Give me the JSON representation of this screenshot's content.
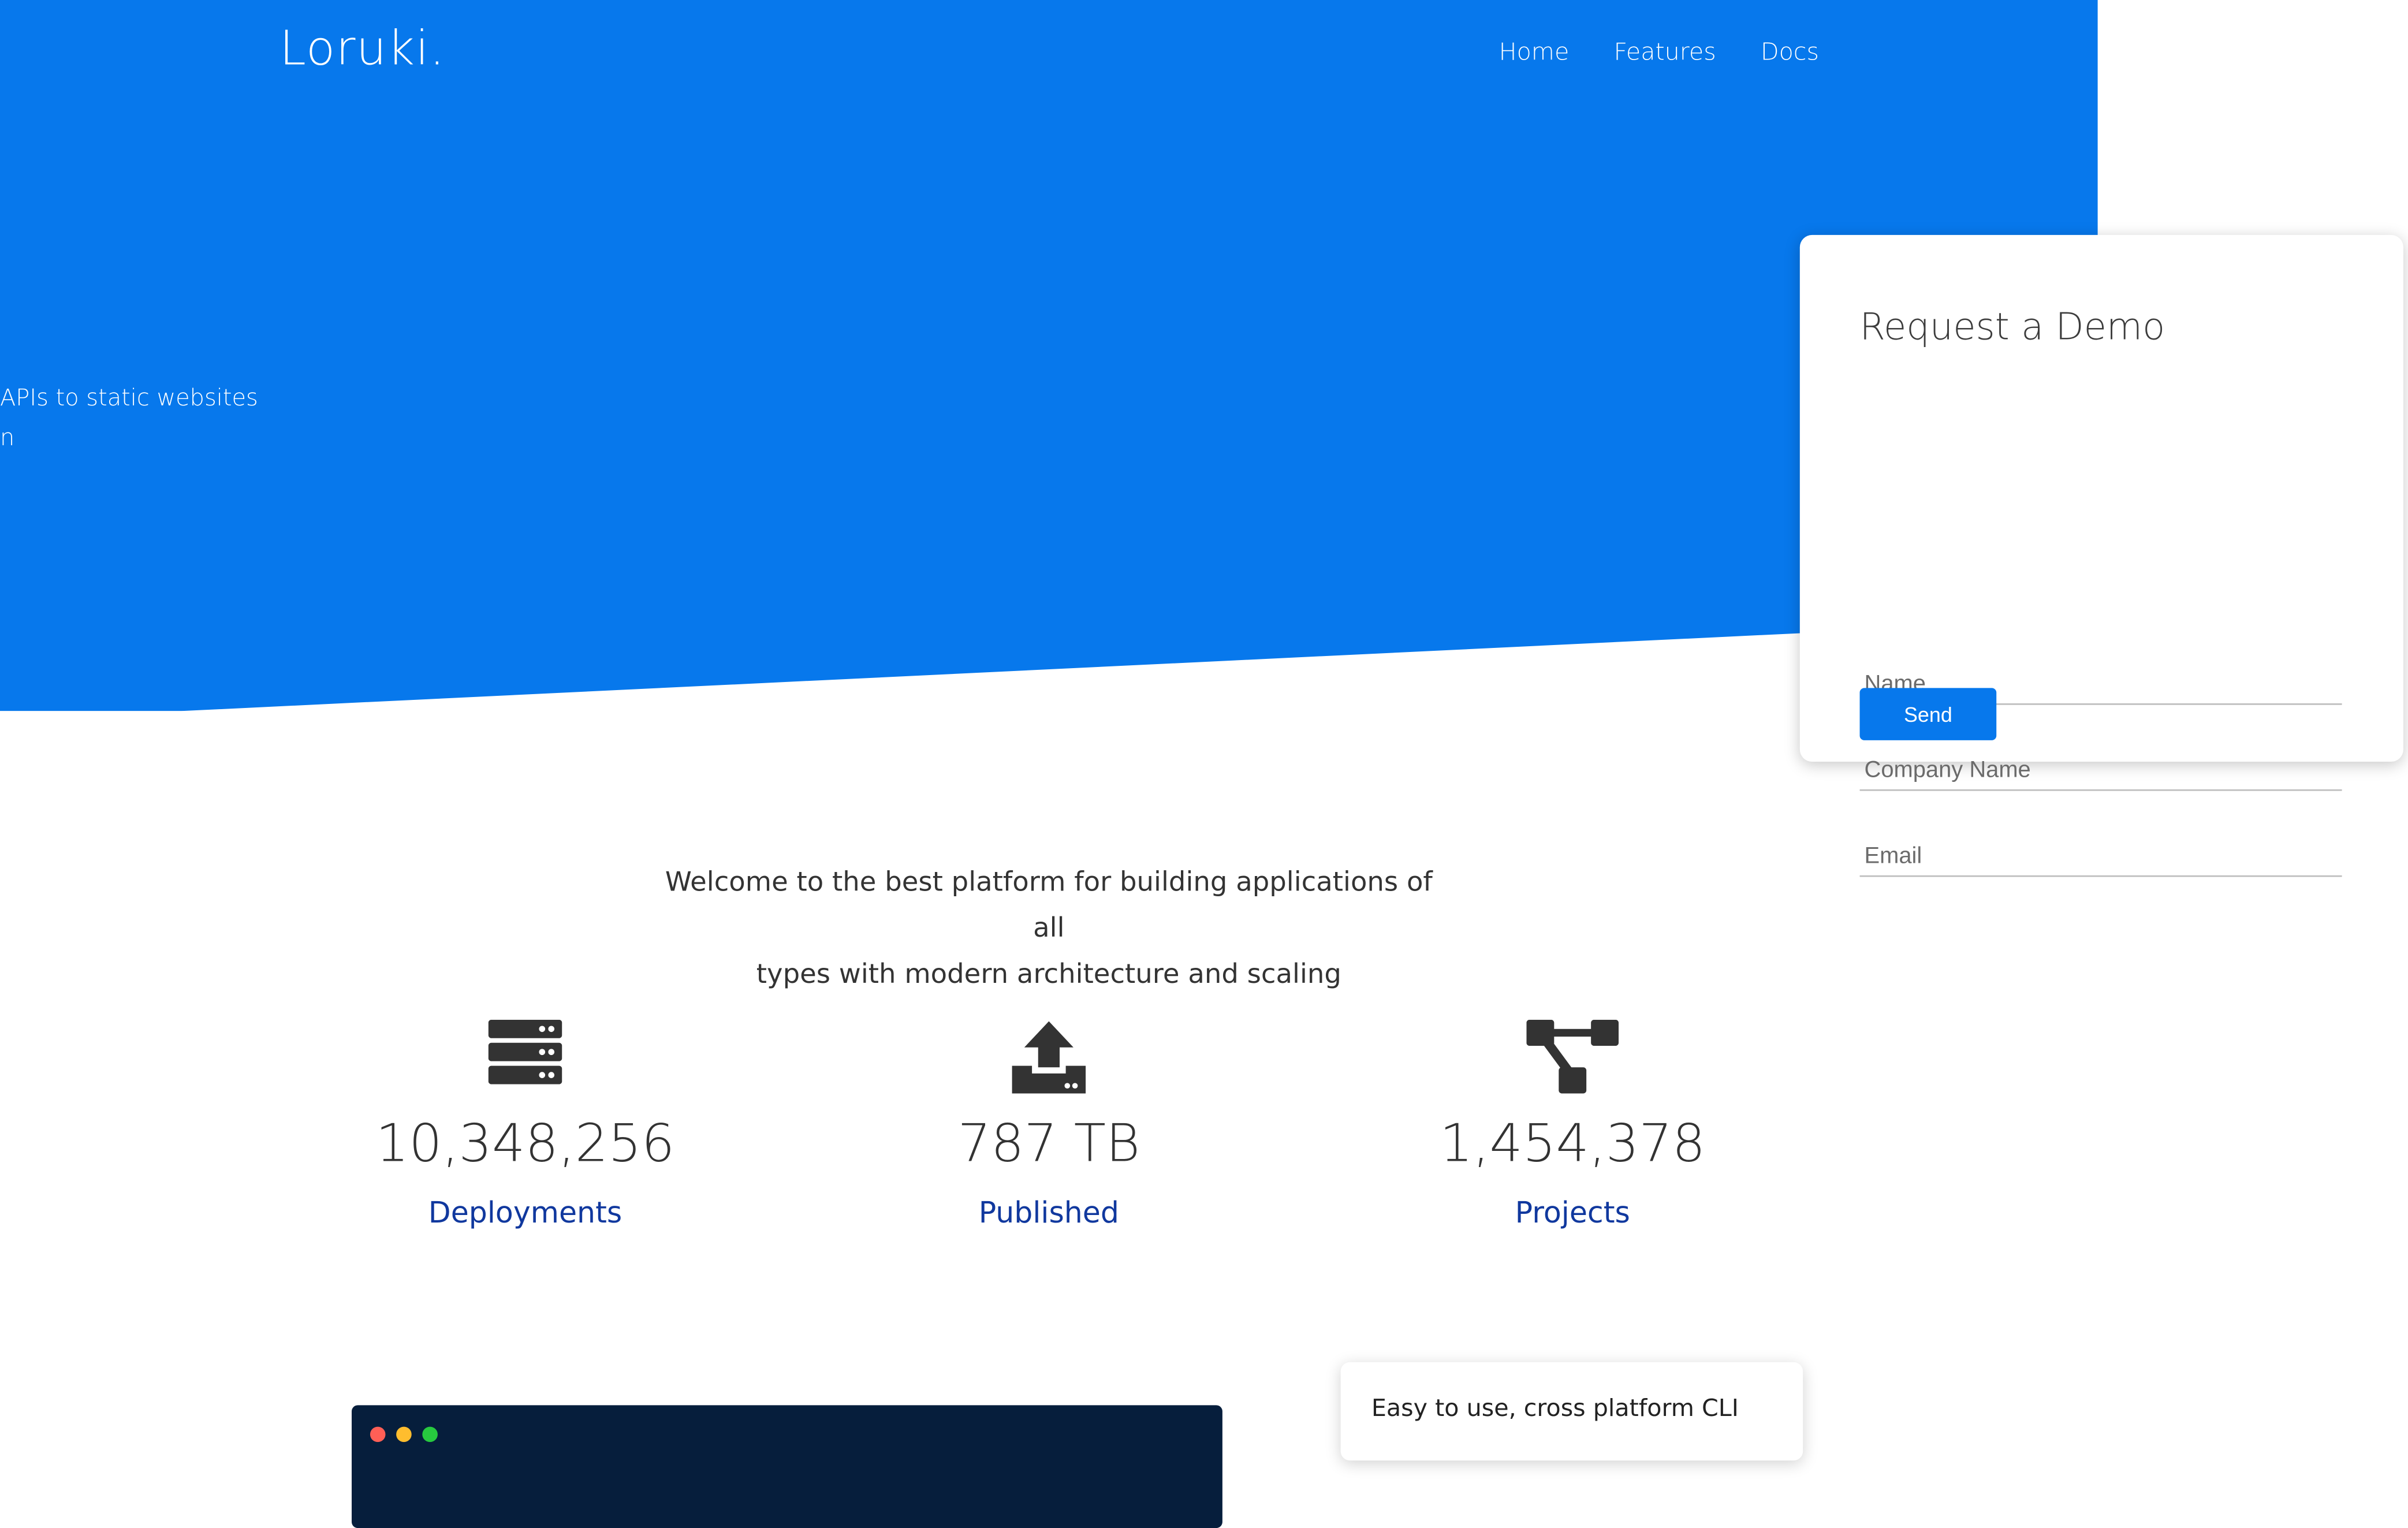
{
  "brand": {
    "logo": "Loruki."
  },
  "nav": {
    "items": [
      "Home",
      "Features",
      "Docs"
    ]
  },
  "hero": {
    "tagline_line1": "APIs to static websites for",
    "tagline_line2": "n"
  },
  "demo_form": {
    "title": "Request a Demo",
    "name_placeholder": "Name",
    "company_placeholder": "Company Name",
    "email_placeholder": "Email",
    "send_label": "Send"
  },
  "intro": {
    "line1": "Welcome to the best platform for building applications of all",
    "line2": "types with modern architecture and scaling"
  },
  "stats": [
    {
      "icon": "server-icon",
      "value": "10,348,256",
      "label": "Deployments"
    },
    {
      "icon": "upload-icon",
      "value": "787 TB",
      "label": "Published"
    },
    {
      "icon": "project-diagram-icon",
      "value": "1,454,378",
      "label": "Projects"
    }
  ],
  "terminal": {
    "dot_colors": [
      "#ff5f56",
      "#ffbd2e",
      "#27c93f"
    ]
  },
  "feature_card": {
    "text": "Easy to use, cross platform CLI"
  },
  "colors": {
    "primary": "#0778ec",
    "stat_label": "#10389e",
    "terminal_bg": "#061e3c",
    "icon": "#333333"
  }
}
